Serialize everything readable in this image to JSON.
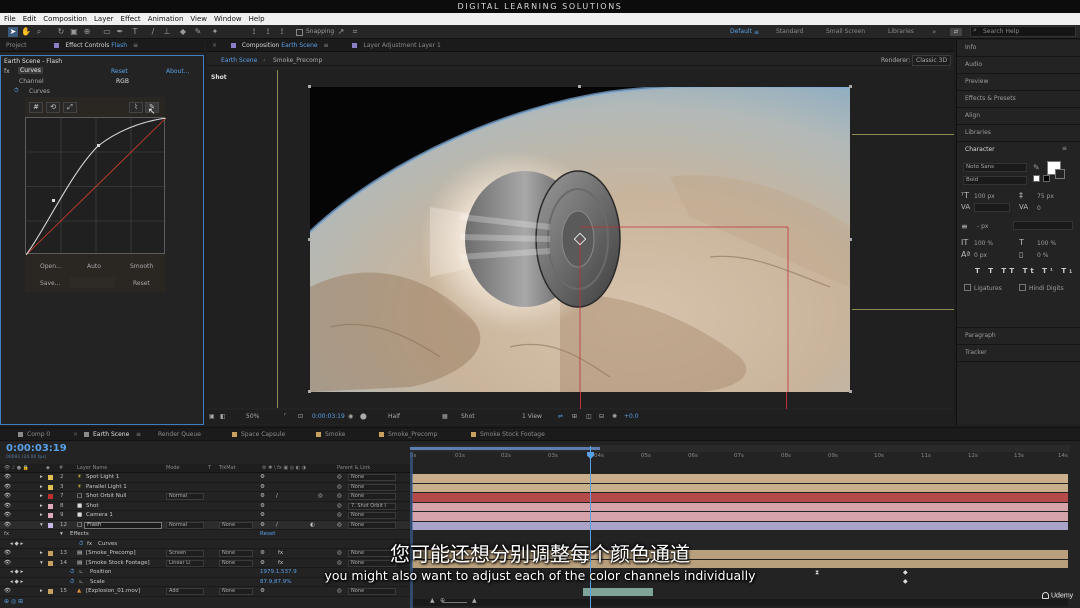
{
  "app_title": "DIGITAL LEARNING SOLUTIONS",
  "menu": [
    "File",
    "Edit",
    "Composition",
    "Layer",
    "Effect",
    "Animation",
    "View",
    "Window",
    "Help"
  ],
  "toolbar": {
    "snapping_label": "Snapping",
    "workspaces": [
      "Default",
      "Standard",
      "Small Screen",
      "Libraries"
    ],
    "search_placeholder": "Search Help"
  },
  "project_panel": {
    "tab_project": "Project",
    "tab_effect_controls": "Effect Controls",
    "tab_effect_layer": "Flash",
    "layer_path": "Earth Scene - Flash",
    "effect_fx": "fx",
    "effect_name": "Curves",
    "reset_label": "Reset",
    "about_label": "About...",
    "channel_label": "Channel",
    "channel_value": "RGB",
    "curves_sub": "Curves",
    "buttons": {
      "open": "Open...",
      "auto": "Auto",
      "smooth": "Smooth",
      "save": "Save...",
      "reset": "Reset"
    }
  },
  "composition_panel": {
    "tab_label": "Composition",
    "tab_comp": "Earth Scene",
    "tab_layer": "Layer  Adjustment Layer 1",
    "crumb_1": "Earth Scene",
    "crumb_2": "Smoke_Precomp",
    "renderer_label": "Renderer:",
    "renderer_value": "Classic 3D",
    "viewer_label": "Shot"
  },
  "viewer_bar": {
    "zoom": "50%",
    "time": "0:00:03:19",
    "resolution": "Half",
    "camera": "Shot",
    "views": "1 View",
    "exposure": "+0.0"
  },
  "right_panel": {
    "items": [
      "Info",
      "Audio",
      "Preview",
      "Effects & Presets",
      "Align",
      "Libraries"
    ],
    "character_title": "Character",
    "font_name": "Noto Sans",
    "font_style": "Bold",
    "font_size": "100 px",
    "leading": "75 px",
    "tracking": "0",
    "indent": "- px",
    "vscale": "100 %",
    "hscale": "100 %",
    "baseline": "0 px",
    "tsume": "0 %",
    "ligatures": "Ligatures",
    "hindi_digits": "Hindi Digits",
    "paragraph": "Paragraph",
    "tracker": "Tracker"
  },
  "timeline": {
    "tabs": [
      {
        "label": "Comp 0",
        "color": "#8a8a8a"
      },
      {
        "label": "Earth Scene",
        "color": "#8a8a8a"
      },
      {
        "label": "Render Queue",
        "color": ""
      },
      {
        "label": "Space Capsule",
        "color": "#c8a060"
      },
      {
        "label": "Smoke",
        "color": "#c8a060"
      },
      {
        "label": "Smoke_Precomp",
        "color": "#c8a060"
      },
      {
        "label": "Smoke Stock Footage",
        "color": "#c8a060"
      }
    ],
    "timecode": "0:00:03:19",
    "fps": "00091 (24.00 fps)",
    "ruler": [
      "0s",
      "01s",
      "02s",
      "03s",
      "04s",
      "05s",
      "06s",
      "07s",
      "08s",
      "09s",
      "10s",
      "11s",
      "12s",
      "13s",
      "14s"
    ],
    "columns": {
      "layer_name": "Layer Name",
      "mode": "Mode",
      "t": "T",
      "trkmat": "TrkMat",
      "parent": "Parent & Link"
    },
    "layers": [
      {
        "num": "2",
        "color": "#e0c050",
        "name": "Spot Light 1",
        "mode": "",
        "trkmat": "",
        "parent": "None",
        "track": "#c9ae8c"
      },
      {
        "num": "3",
        "color": "#e0c050",
        "name": "Parallel Light 1",
        "mode": "",
        "trkmat": "",
        "parent": "None",
        "track": "#c9ae8c"
      },
      {
        "num": "7",
        "color": "#c03030",
        "name": "Shot Orbit Null",
        "mode": "Normal",
        "trkmat": "",
        "parent": "None",
        "track": "#b54a4a"
      },
      {
        "num": "8",
        "color": "#e0a8b8",
        "name": "Shot",
        "mode": "",
        "trkmat": "",
        "parent": "7. Shot Orbit I",
        "track": "#d6a3ab"
      },
      {
        "num": "9",
        "color": "#e0a8b8",
        "name": "Camera 1",
        "mode": "",
        "trkmat": "",
        "parent": "None",
        "track": "#d6a3ab"
      },
      {
        "num": "12",
        "color": "#c8b8e8",
        "name": "Flash",
        "mode": "Normal",
        "trkmat": "None",
        "parent": "None",
        "track": "#a9a3c8"
      }
    ],
    "flash_effects": "Effects",
    "flash_reset": "Reset",
    "flash_curves": "Curves",
    "lower_layers": [
      {
        "num": "13",
        "name": "[Smoke_Precomp]",
        "mode": "Screen",
        "trkmat": "None",
        "parent": "None"
      },
      {
        "num": "14",
        "name": "[Smoke Stock Footage]",
        "mode": "Linear Li",
        "trkmat": "None",
        "parent": "None"
      }
    ],
    "position_label": "Position",
    "position_value": "1979.1,537.9",
    "scale_label": "Scale",
    "scale_value": "87.9,87.9%",
    "explosion": {
      "num": "15",
      "name": "[Explosion_01.mov]",
      "mode": "Add",
      "trkmat": "None",
      "parent": "None"
    }
  },
  "subtitles": {
    "cn": "您可能还想分别调整每个颜色通道",
    "en": "you might also want to adjust each of the color channels individually"
  },
  "watermark": "Udemy"
}
